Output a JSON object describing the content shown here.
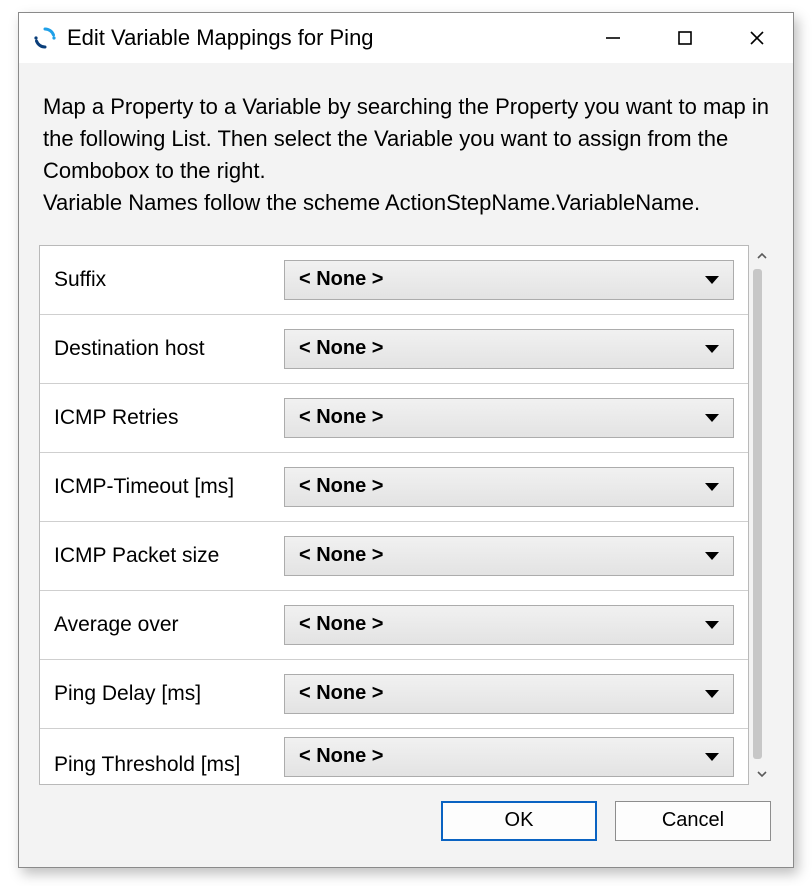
{
  "window": {
    "title": "Edit Variable Mappings for Ping"
  },
  "instructions": {
    "line1": "Map a Property to a Variable by searching the Property you want to map in the following List. Then select the Variable you want to assign from the Combobox to the right.",
    "line2": "Variable Names follow the scheme ActionStepName.VariableName."
  },
  "combo_default": "< None >",
  "properties": [
    {
      "name": "Suffix",
      "value": "< None >"
    },
    {
      "name": "Destination host",
      "value": "< None >"
    },
    {
      "name": "ICMP Retries",
      "value": "< None >"
    },
    {
      "name": "ICMP-Timeout [ms]",
      "value": "< None >"
    },
    {
      "name": "ICMP Packet size",
      "value": "< None >"
    },
    {
      "name": "Average over",
      "value": "< None >"
    },
    {
      "name": "Ping Delay [ms]",
      "value": "< None >"
    },
    {
      "name": "Ping Threshold [ms]",
      "value": "< None >"
    }
  ],
  "buttons": {
    "ok": "OK",
    "cancel": "Cancel"
  }
}
